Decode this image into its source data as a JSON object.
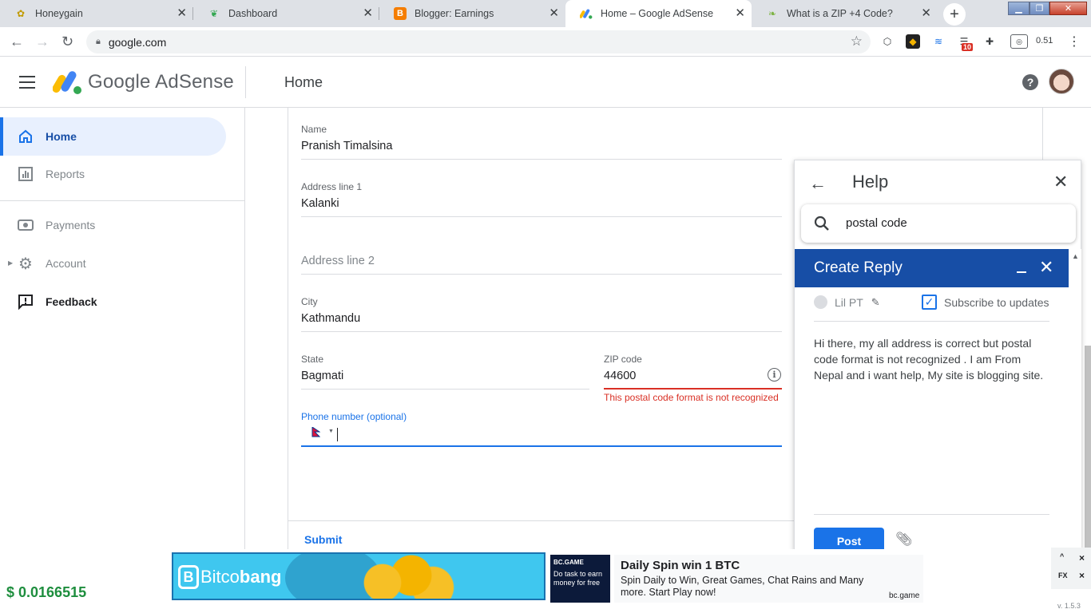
{
  "browser": {
    "tabs": [
      {
        "title": "Honeygain",
        "favicon": "honeygain-icon"
      },
      {
        "title": "Dashboard",
        "favicon": "dashboard-icon"
      },
      {
        "title": "Blogger: Earnings",
        "favicon": "blogger-icon"
      },
      {
        "title": "Home – Google AdSense",
        "favicon": "adsense-icon",
        "active": true
      },
      {
        "title": "What is a ZIP +4 Code?",
        "favicon": "leaf-icon"
      }
    ],
    "new_tab": "+",
    "url": "google.com",
    "extension_badge": "10",
    "extension_value": "0.51"
  },
  "header": {
    "brand": "Google AdSense",
    "page_title": "Home"
  },
  "sidebar": {
    "items": [
      {
        "label": "Home",
        "icon": "home-icon",
        "active": true
      },
      {
        "label": "Reports",
        "icon": "reports-icon"
      },
      {
        "label": "Payments",
        "icon": "payments-icon"
      },
      {
        "label": "Account",
        "icon": "gear-icon"
      },
      {
        "label": "Feedback",
        "icon": "feedback-icon"
      }
    ]
  },
  "form": {
    "name": {
      "label": "Name",
      "value": "Pranish Timalsina"
    },
    "address1": {
      "label": "Address line 1",
      "value": "Kalanki"
    },
    "address2": {
      "placeholder": "Address line 2"
    },
    "city": {
      "label": "City",
      "value": "Kathmandu"
    },
    "state": {
      "label": "State",
      "value": "Bagmati"
    },
    "zip": {
      "label": "ZIP code",
      "value": "44600",
      "error": "This postal code format is not recognized"
    },
    "phone": {
      "label": "Phone number (optional)"
    },
    "submit": "Submit"
  },
  "help": {
    "title": "Help",
    "search_value": "postal code",
    "reply": {
      "title": "Create Reply",
      "user": "Lil PT",
      "subscribe_label": "Subscribe to updates",
      "subscribed": true,
      "body": "Hi there, my all address is correct but postal code format is not recognized . I am From Nepal and i want help, My site is blogging site.",
      "post_label": "Post"
    }
  },
  "ads": {
    "balance": "$ 0.0166515",
    "banner1_brand_a": "Bitco",
    "banner1_brand_b": "bang",
    "banner2_image_brand": "BC.GAME",
    "banner2_image_text": "Do task to earn money for free",
    "banner2_title": "Daily Spin win 1 BTC",
    "banner2_desc": "Spin Daily to Win, Great Games, Chat Rains and Many more. Start Play now!",
    "banner2_domain": "bc.game",
    "controls": {
      "up": "^",
      "close": "×",
      "fx": "FX",
      "x2": "×"
    },
    "version": "v. 1.5.3"
  },
  "colors": {
    "accent": "#1a73e8",
    "error": "#d93025",
    "reply_header": "#174ea6",
    "balance": "#1e8e3e"
  }
}
